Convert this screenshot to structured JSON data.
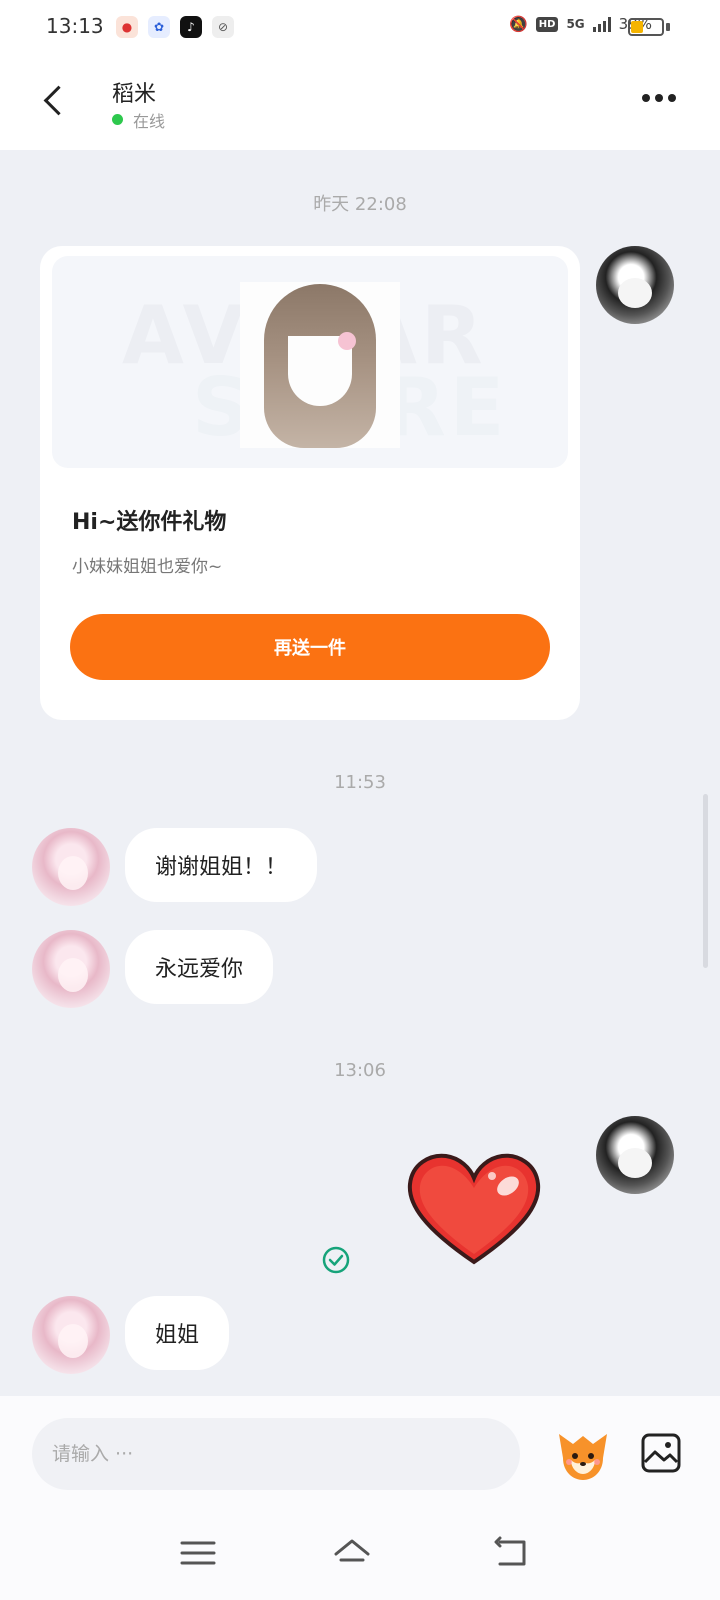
{
  "status_bar": {
    "time": "13:13",
    "network": "5G",
    "hd": "HD",
    "battery_percent": "39%",
    "battery_level": 0.39
  },
  "header": {
    "contact_name": "稻米",
    "status": "在线"
  },
  "messages": {
    "timestamp_1": "昨天 22:08",
    "gift_card": {
      "title": "Hi~送你件礼物",
      "subtitle": "小妹妹姐姐也爱你~",
      "button_label": "再送一件",
      "banner_text_1": "AVATAR",
      "banner_text_2": "STORE"
    },
    "timestamp_2": "11:53",
    "bubble_1": "谢谢姐姐！！",
    "bubble_2": "永远爱你",
    "timestamp_3": "13:06",
    "bubble_3": "姐姐"
  },
  "input": {
    "placeholder": "请输入 ···"
  },
  "colors": {
    "accent": "#fb7212",
    "online": "#2dc84d",
    "check": "#16a37a",
    "heart": "#e8332f"
  },
  "icons": {
    "emoji": "fox-emoji-icon",
    "image": "image-icon",
    "sent": "check-circle-icon"
  }
}
